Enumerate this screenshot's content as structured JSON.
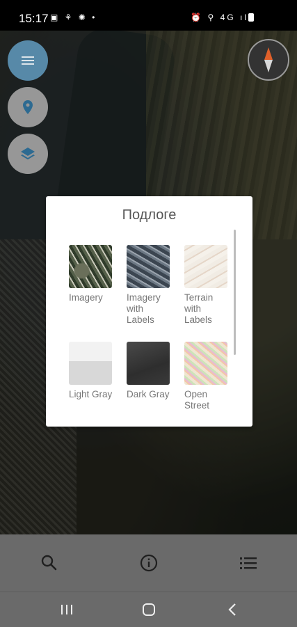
{
  "status_bar": {
    "time": "15:17",
    "left_icons": "▣ ⚘ ✺ •",
    "right_icons": "⏰ ⚲ 4G ıl"
  },
  "map_controls": {
    "menu_button": "menu-icon",
    "location_button": "location-pin-icon",
    "layers_button": "layers-icon",
    "compass": "compass-icon"
  },
  "dialog": {
    "title": "Подлоге",
    "tiles": [
      {
        "label": "Imagery"
      },
      {
        "label": "Imagery with Labels"
      },
      {
        "label": "Terrain with Labels"
      },
      {
        "label": "Light Gray"
      },
      {
        "label": "Dark Gray"
      },
      {
        "label": "Open Street"
      }
    ]
  },
  "bottom_bar": {
    "search": "search-icon",
    "info": "info-icon",
    "list": "list-icon"
  },
  "nav_bar": {
    "recents": "recents-icon",
    "home": "home-icon",
    "back": "back-icon"
  },
  "colors": {
    "menu_fab": "#5b8fb0",
    "fab": "#9e9e9e",
    "bottom_bar": "#6a6a6a",
    "compass_north": "#e0602a"
  }
}
